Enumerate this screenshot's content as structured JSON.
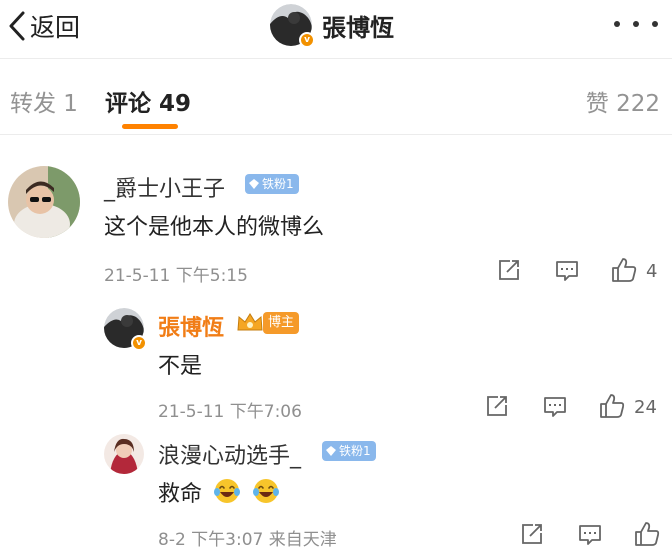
{
  "header": {
    "back_label": "返回",
    "title": "張博恆"
  },
  "tabs": {
    "repost": "转发 1",
    "comments": "评论 49",
    "likes": "赞 222"
  },
  "comments": [
    {
      "username": "_爵士小王子",
      "badge": "铁粉1",
      "text": "这个是他本人的微博么",
      "time": "21-5-11 下午5:15",
      "likes": "4"
    },
    {
      "username": "張博恆",
      "badge": "博主",
      "text": "不是",
      "time": "21-5-11 下午7:06",
      "likes": "24"
    },
    {
      "username": "浪漫心动选手_",
      "badge": "铁粉1",
      "text": "救命",
      "time": "8-2 下午3:07 来自天津",
      "likes": ""
    }
  ],
  "colors": {
    "accent": "#ff8200",
    "author": "#f17d16",
    "fan_badge": "#8ab8ec",
    "meta": "#8f8f8f"
  },
  "icons": [
    "chevron-left-icon",
    "more-dots-icon",
    "verified-v-icon",
    "diamond-icon",
    "crown-icon",
    "repost-icon",
    "reply-icon",
    "like-icon",
    "laughing-crying-emoji"
  ]
}
